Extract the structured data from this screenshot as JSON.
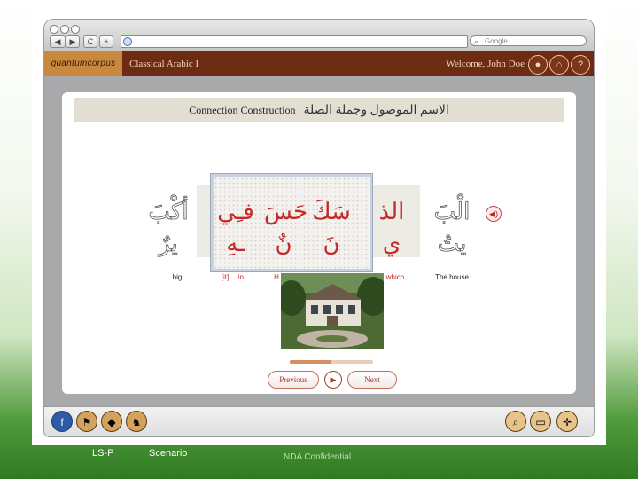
{
  "browser": {
    "nav": {
      "back": "◀",
      "forward": "▶",
      "reload": "C",
      "add": "+"
    },
    "search_placeholder": "Google"
  },
  "header": {
    "logo": "quantumcorpus",
    "course": "Classical Arabic I",
    "welcome": "Welcome, John Doe"
  },
  "lesson": {
    "title_en": "Connection Construction",
    "title_ar": "الاسم الموصول وجملة الصلة",
    "words": [
      {
        "top": "أكْبَ",
        "bottom": "يرٌ",
        "gloss": "big",
        "style": "outline"
      },
      {
        "top": "فـِي",
        "bottom": "ـهِ",
        "gloss": "[it]",
        "style": "red"
      },
      {
        "top": "",
        "bottom": "",
        "gloss": "in",
        "style": "red"
      },
      {
        "top": "حَسَ",
        "bottom": "نٌ",
        "gloss": "H",
        "style": "red"
      },
      {
        "top": "سَكَ",
        "bottom": "نَ",
        "gloss": "",
        "style": "red"
      },
      {
        "top": "الذ",
        "bottom": "ي",
        "gloss": "which",
        "style": "red"
      },
      {
        "top": "الْبَ",
        "bottom": "يتُ",
        "gloss": "The house",
        "style": "outline"
      }
    ]
  },
  "nav": {
    "previous": "Previous",
    "next": "Next",
    "play": "▶"
  },
  "progress": {
    "fraction": 0.5
  },
  "toolbar_icons": [
    "facebook-icon",
    "flag-icon",
    "map-icon",
    "camel-icon",
    "search-icon",
    "book-icon",
    "compass-icon"
  ],
  "footer": {
    "left1": "LS-P",
    "left2": "Scenario",
    "nda": "NDA Confidential"
  },
  "colors": {
    "header": "#6e2b14",
    "accent": "#c52a2a",
    "logo_bg": "#c8893e"
  }
}
